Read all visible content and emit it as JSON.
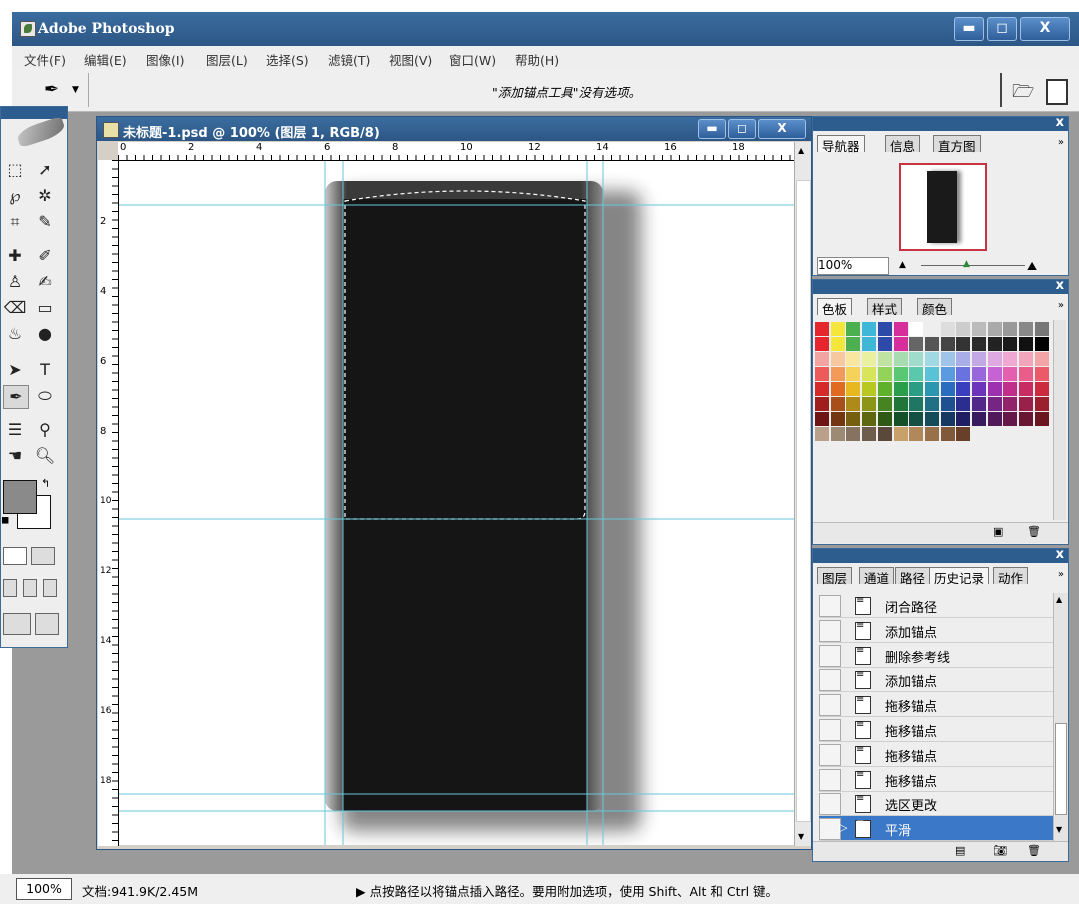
{
  "app": {
    "title": "Adobe Photoshop"
  },
  "window_buttons": [
    "▬",
    "◻",
    "X"
  ],
  "menu": [
    "文件(F)",
    "编辑(E)",
    "图像(I)",
    "图层(L)",
    "选择(S)",
    "滤镜(T)",
    "视图(V)",
    "窗口(W)",
    "帮助(H)"
  ],
  "options_bar": {
    "message": "\"添加锚点工具\"没有选项。"
  },
  "document": {
    "title": "未标题-1.psd @ 100% (图层 1, RGB/8)",
    "h_ruler": [
      "0",
      "2",
      "4",
      "6",
      "8",
      "10",
      "12",
      "14",
      "16",
      "18"
    ],
    "v_ruler": [
      "2",
      "4",
      "6",
      "8",
      "10",
      "12",
      "14",
      "16",
      "18"
    ]
  },
  "navigator": {
    "tabs": [
      "导航器",
      "信息",
      "直方图"
    ],
    "zoom": "100%"
  },
  "swatches": {
    "tabs": [
      "色板",
      "样式",
      "颜色"
    ]
  },
  "history": {
    "tabs": [
      "图层",
      "通道",
      "路径",
      "历史记录",
      "动作"
    ],
    "items": [
      "闭合路径",
      "添加锚点",
      "删除参考线",
      "添加锚点",
      "拖移锚点",
      "拖移锚点",
      "拖移锚点",
      "拖移锚点",
      "选区更改",
      "平滑"
    ],
    "selected_index": 9
  },
  "status": {
    "zoom": "100%",
    "doc": "文档:941.9K/2.45M",
    "hint": "▶  点按路径以将锚点插入路径。要用附加选项，使用 Shift、Alt 和 Ctrl 键。"
  },
  "colors": {
    "title_bar": "#2c5684",
    "history_selected": "#3c78c8",
    "guide": "#66c8dc"
  }
}
